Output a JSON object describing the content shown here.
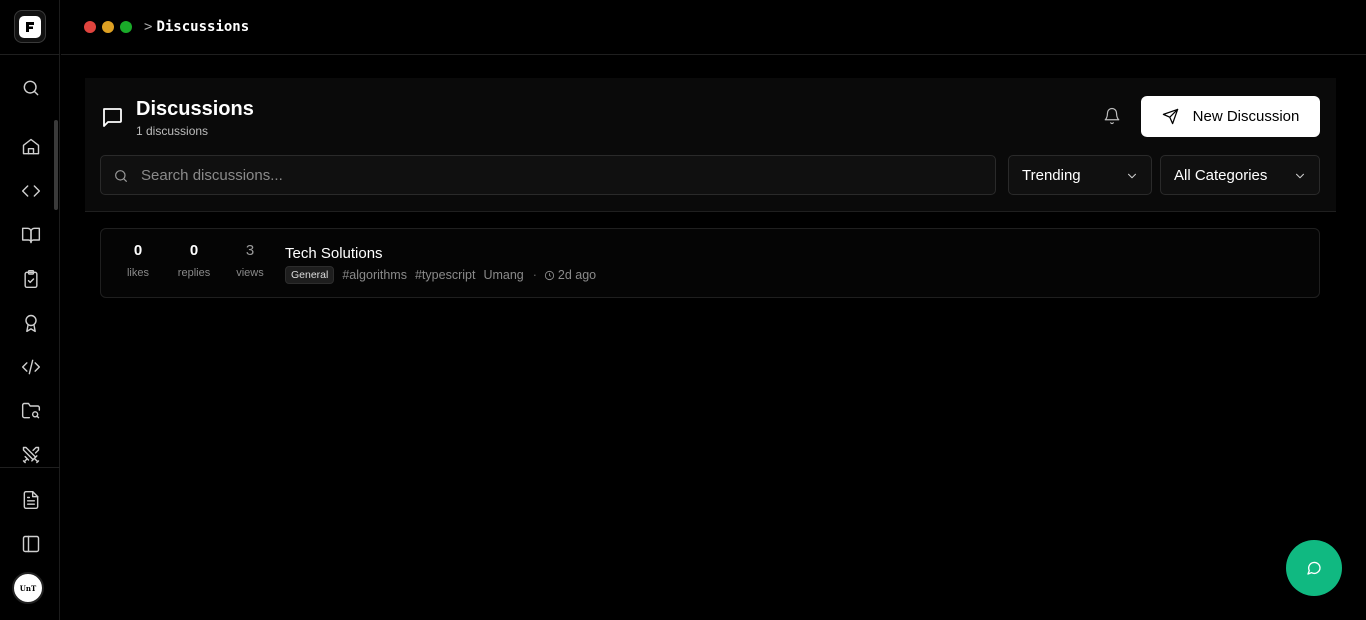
{
  "header": {
    "breadcrumb_sep": ">",
    "breadcrumb_current": "Discussions",
    "window_dots": [
      "#e0443e",
      "#dea123",
      "#1aab29"
    ]
  },
  "sidebar": {
    "logo": "logo-icon",
    "avatar_text": "UnT",
    "items": [
      {
        "name": "search-icon"
      },
      {
        "name": "home-icon"
      },
      {
        "name": "code-icon"
      },
      {
        "name": "book-icon"
      },
      {
        "name": "clipboard-check-icon"
      },
      {
        "name": "award-icon"
      },
      {
        "name": "code-xml-icon"
      },
      {
        "name": "folder-search-icon"
      },
      {
        "name": "swords-icon"
      },
      {
        "name": "file-text-icon"
      },
      {
        "name": "panel-left-icon"
      }
    ]
  },
  "page": {
    "title": "Discussions",
    "subtitle": "1 discussions",
    "new_button_label": "New Discussion"
  },
  "search": {
    "placeholder": "Search discussions...",
    "value": ""
  },
  "filters": {
    "sort": "Trending",
    "category": "All Categories"
  },
  "discussions": [
    {
      "likes": "0",
      "likes_label": "likes",
      "replies": "0",
      "replies_label": "replies",
      "views": "3",
      "views_label": "views",
      "title": "Tech Solutions",
      "category": "General",
      "tags": [
        "#algorithms",
        "#typescript"
      ],
      "author": "Umang",
      "separator": "·",
      "time": "2d ago"
    }
  ],
  "colors": {
    "accent": "#10b981",
    "background": "#000000",
    "panel": "#0a0a0a"
  }
}
